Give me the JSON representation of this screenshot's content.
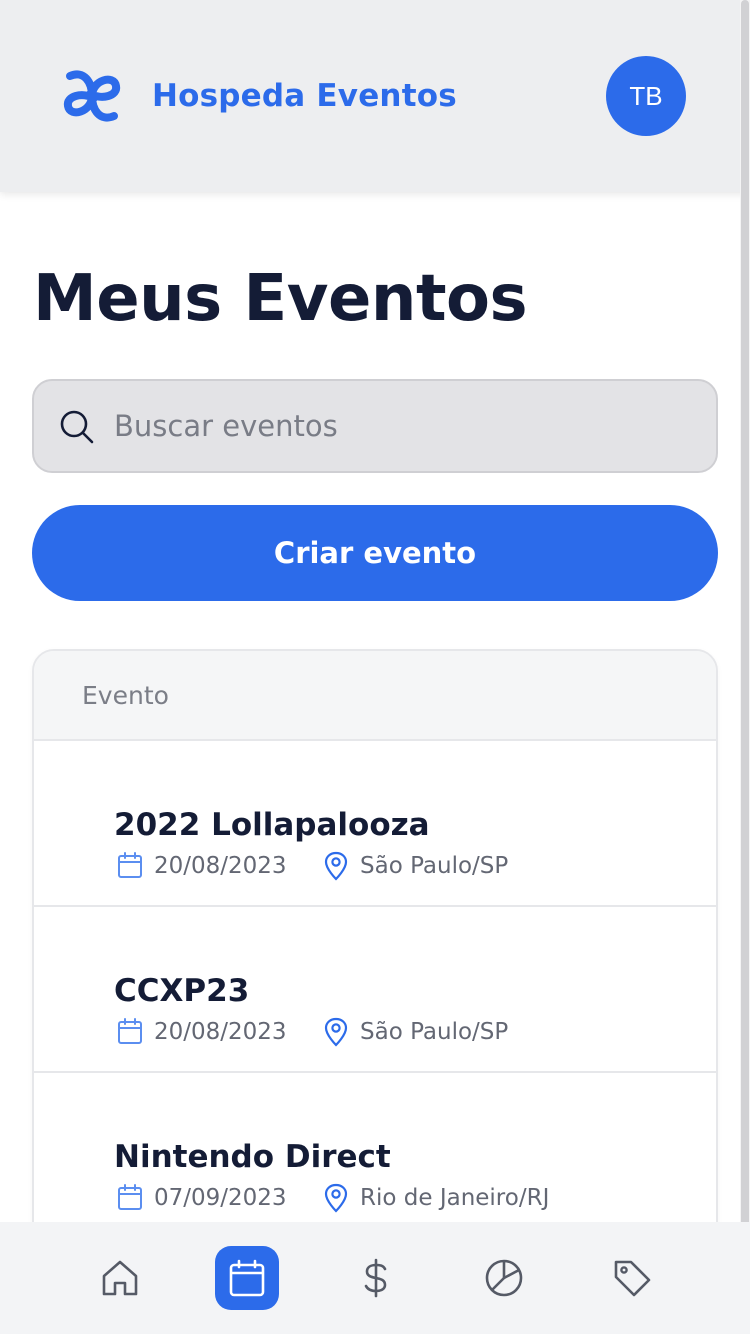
{
  "header": {
    "app_title": "Hospeda Eventos",
    "avatar_initials": "TB",
    "logo_icon": "hospeda-logo-icon"
  },
  "page": {
    "title": "Meus Eventos"
  },
  "search": {
    "placeholder": "Buscar eventos",
    "value": "",
    "icon": "search-icon"
  },
  "actions": {
    "create_label": "Criar evento"
  },
  "events_table": {
    "column_header": "Evento",
    "rows": [
      {
        "name": "2022 Lollapalooza",
        "date": "20/08/2023",
        "location": "São Paulo/SP"
      },
      {
        "name": "CCXP23",
        "date": "20/08/2023",
        "location": "São Paulo/SP"
      },
      {
        "name": "Nintendo Direct",
        "date": "07/09/2023",
        "location": "Rio de Janeiro/RJ"
      }
    ]
  },
  "bottom_nav": {
    "items": [
      {
        "icon": "home-icon",
        "active": false
      },
      {
        "icon": "calendar-icon",
        "active": true
      },
      {
        "icon": "dollar-icon",
        "active": false
      },
      {
        "icon": "pie-chart-icon",
        "active": false
      },
      {
        "icon": "tag-icon",
        "active": false
      }
    ]
  },
  "colors": {
    "accent": "#2c6bea",
    "text_dark": "#141c36",
    "text_muted": "#636773",
    "header_bg": "#edeef0"
  }
}
